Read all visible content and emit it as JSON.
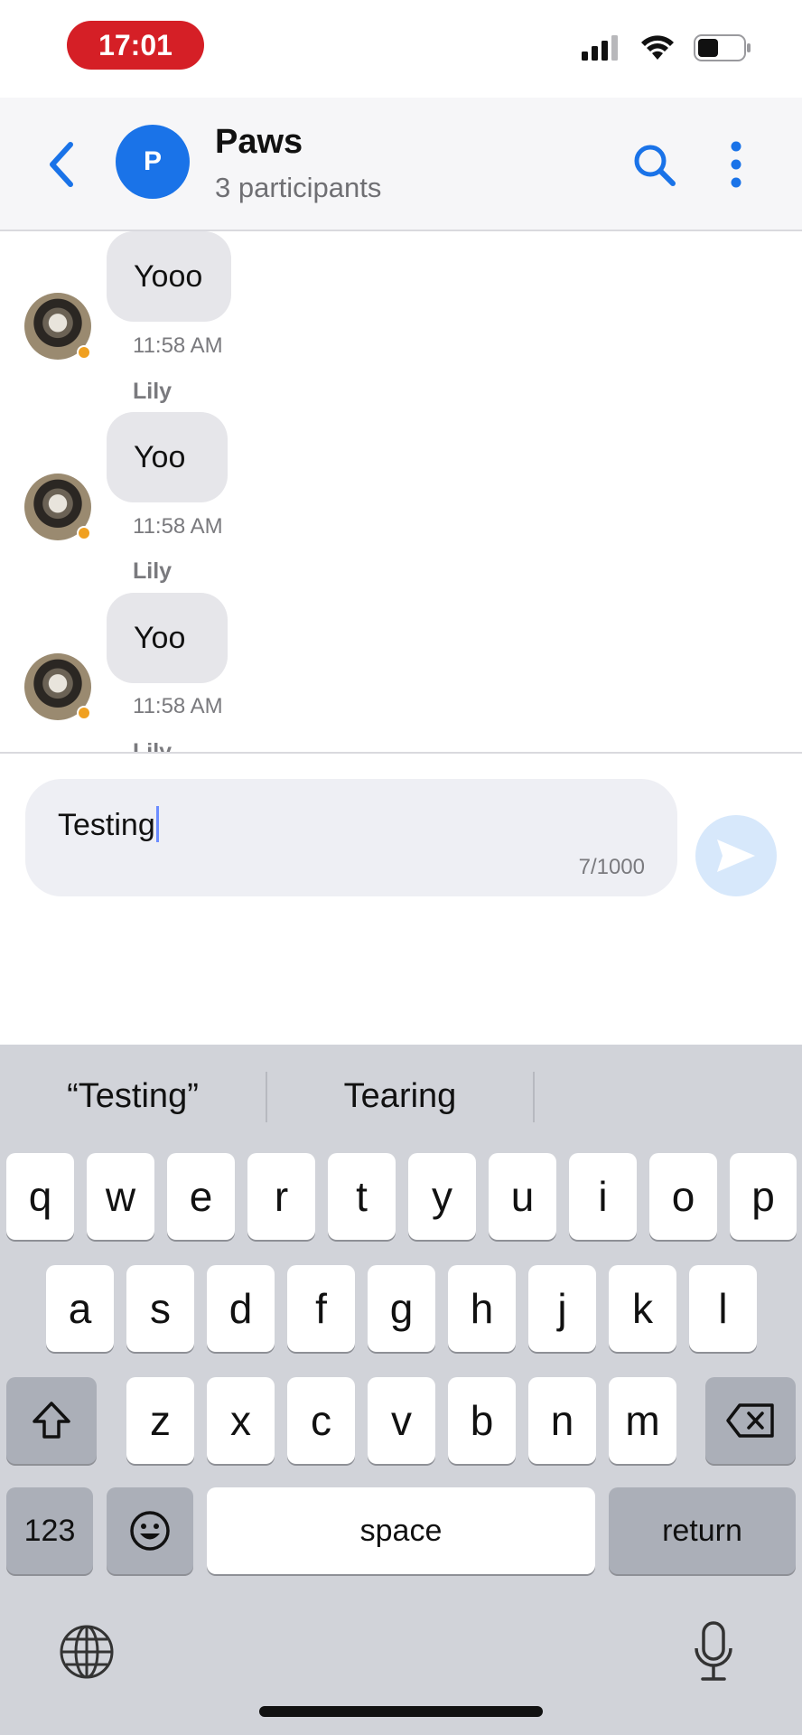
{
  "status_bar": {
    "time": "17:01"
  },
  "header": {
    "group_initial": "P",
    "title": "Paws",
    "subtitle": "3 participants"
  },
  "messages": [
    {
      "text": "Yooo",
      "time": "11:58 AM",
      "sender_below": "Lily"
    },
    {
      "text": "Yoo",
      "time": "11:58 AM",
      "sender_below": "Lily"
    },
    {
      "text": "Yoo",
      "time": "11:58 AM",
      "sender_below": "Lily"
    }
  ],
  "composer": {
    "value": "Testing",
    "char_count": "7/1000"
  },
  "keyboard": {
    "suggestions": [
      "“Testing”",
      "Tearing",
      ""
    ],
    "row1": [
      "q",
      "w",
      "e",
      "r",
      "t",
      "y",
      "u",
      "i",
      "o",
      "p"
    ],
    "row2": [
      "a",
      "s",
      "d",
      "f",
      "g",
      "h",
      "j",
      "k",
      "l"
    ],
    "row3": [
      "z",
      "x",
      "c",
      "v",
      "b",
      "n",
      "m"
    ],
    "numbers_label": "123",
    "space_label": "space",
    "return_label": "return"
  },
  "colors": {
    "accent": "#1a73e8",
    "time_pill": "#d51f26",
    "presence": "#f0a020",
    "send_disabled": "#d7e8fb"
  }
}
